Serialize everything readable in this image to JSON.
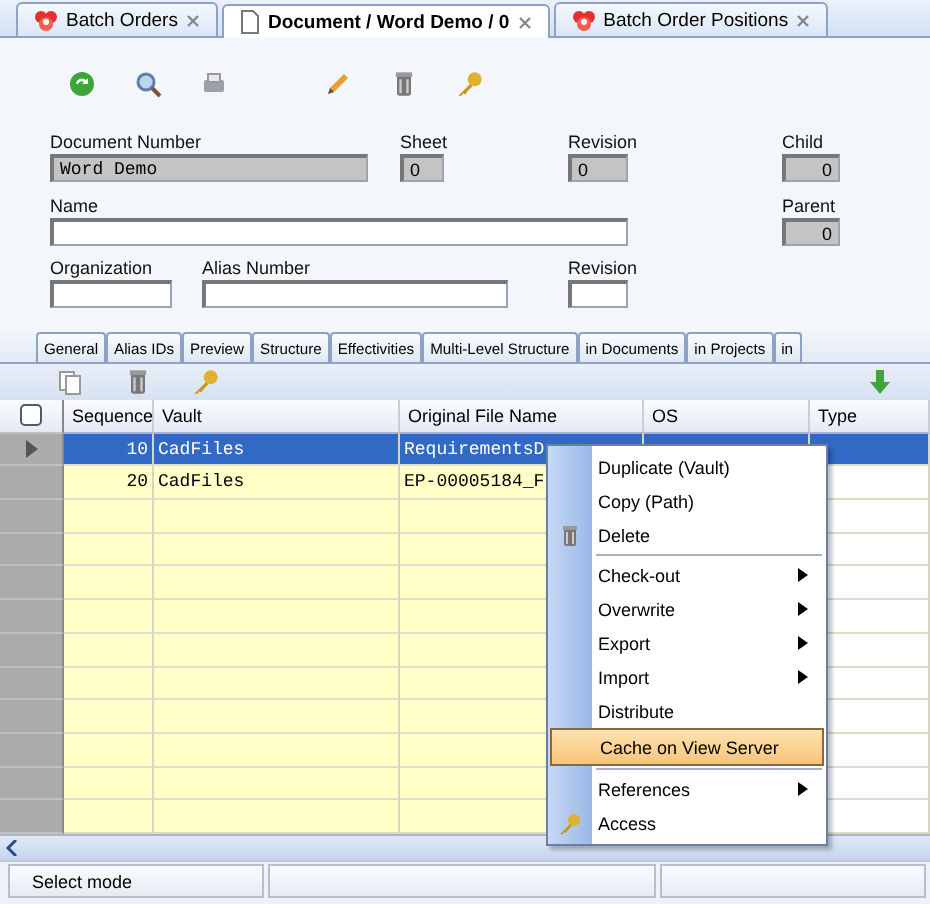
{
  "tabs": [
    {
      "label": "Batch Orders",
      "kind": "batch",
      "selected": false
    },
    {
      "label": "Document / Word Demo / 0",
      "kind": "document",
      "selected": true
    },
    {
      "label": "Batch Order Positions",
      "kind": "batch",
      "selected": false
    }
  ],
  "form": {
    "document_number": {
      "label": "Document Number",
      "value": "Word Demo"
    },
    "sheet": {
      "label": "Sheet",
      "value": "0"
    },
    "revision": {
      "label": "Revision",
      "value": "0"
    },
    "child": {
      "label": "Child",
      "value": "0"
    },
    "name": {
      "label": "Name"
    },
    "parent": {
      "label": "Parent",
      "value": "0"
    },
    "organization": {
      "label": "Organization"
    },
    "alias_number": {
      "label": "Alias Number"
    },
    "revision_2": {
      "label": "Revision"
    }
  },
  "detail_tabs": [
    "General",
    "Alias IDs",
    "Preview",
    "Structure",
    "Effectivities",
    "Multi-Level Structure",
    "in Documents",
    "in Projects",
    "in"
  ],
  "table": {
    "select_all": {
      "checked": false
    },
    "columns": [
      "Sequence",
      "Vault",
      "Original File Name",
      "OS",
      "Type"
    ],
    "rows": [
      {
        "selected": true,
        "cells": [
          "10",
          "CadFiles",
          "RequirementsD",
          "",
          ""
        ]
      },
      {
        "selected": false,
        "cells": [
          "20",
          "CadFiles",
          "EP-00005184_F",
          "",
          ""
        ]
      }
    ]
  },
  "context_menu": [
    {
      "label": "Duplicate (Vault)",
      "kind": "item",
      "separator_before": false,
      "selected": false
    },
    {
      "label": "Copy (Path)",
      "kind": "item",
      "separator_before": false,
      "selected": false
    },
    {
      "label": "Delete",
      "kind": "delete",
      "separator_before": false,
      "selected": false
    },
    {
      "label": "Check-out",
      "kind": "submenu",
      "separator_before": true,
      "selected": false
    },
    {
      "label": "Overwrite",
      "kind": "submenu",
      "separator_before": false,
      "selected": false
    },
    {
      "label": "Export",
      "kind": "submenu",
      "separator_before": false,
      "selected": false
    },
    {
      "label": "Import",
      "kind": "submenu",
      "separator_before": false,
      "selected": false
    },
    {
      "label": "Distribute",
      "kind": "item",
      "separator_before": false,
      "selected": false
    },
    {
      "label": "Cache on View Server",
      "kind": "item",
      "separator_before": false,
      "selected": true
    },
    {
      "label": "References",
      "kind": "submenu",
      "separator_before": true,
      "selected": false
    },
    {
      "label": "Access",
      "kind": "access",
      "separator_before": false,
      "selected": false
    }
  ],
  "status_bar": [
    "Select mode"
  ]
}
